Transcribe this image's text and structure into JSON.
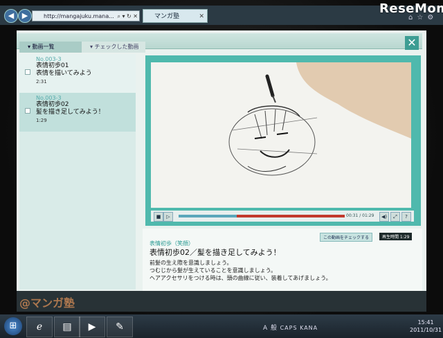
{
  "browser": {
    "address": "http://mangajuku.mana...",
    "tab_title": "マンガ塾",
    "logo": "ReseMom"
  },
  "panel": {
    "tabs": [
      {
        "label": "▾ 動画一覧"
      },
      {
        "label": "▾ チェックした動画"
      }
    ],
    "close": "✕"
  },
  "videos": [
    {
      "number": "No.003-3",
      "title_line1": "表情初歩01",
      "title_line2": "表情を描いてみよう",
      "duration": "2:31"
    },
    {
      "number": "No.003-3",
      "title_line1": "表情初歩02",
      "title_line2": "髪を描き足してみよう！",
      "duration": "1:29"
    }
  ],
  "player": {
    "timecode": "00:31 / 01:29",
    "played_fraction": 0.35
  },
  "info": {
    "check_button": "この動画をチェックする",
    "duration_badge": "再生時間 1:29",
    "category": "表情初歩（笑顔）",
    "title": "表情初歩02／髪を描き足してみよう！",
    "desc_lines": [
      "前髪の生え際を意識しましょう。",
      "つむじから髪が生えていることを意識しましょう。",
      "ヘアアクセサリをつける時は、頭の曲線に従い、装着してあげましょう。"
    ]
  },
  "footer": {
    "manga_logo": "@マンガ塾"
  },
  "taskbar": {
    "ime": "A 般",
    "caps": "CAPS KANA",
    "time": "15:41",
    "date": "2011/10/31"
  }
}
